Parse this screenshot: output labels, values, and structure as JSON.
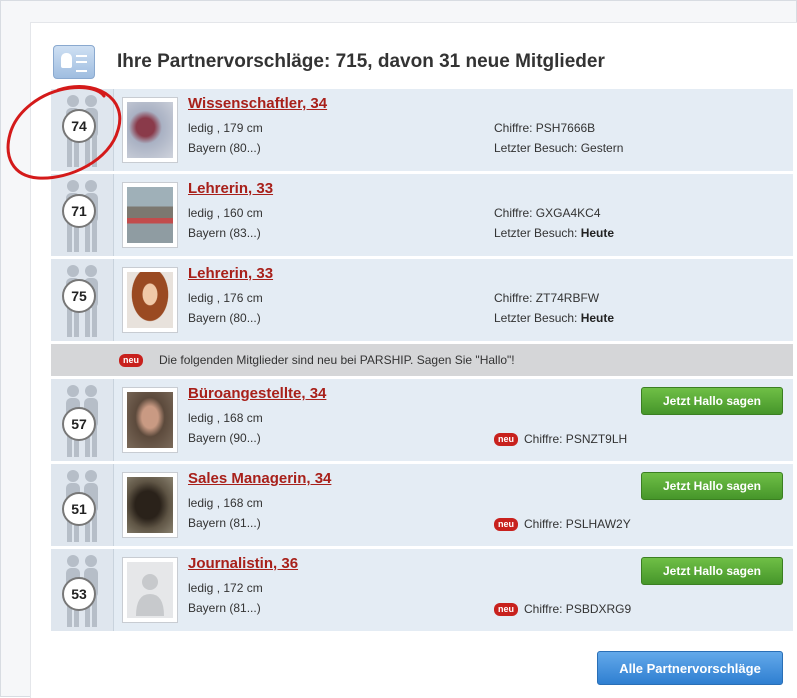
{
  "header": {
    "title": "Ihre Partnervorschläge: 715, davon 31 neue Mitglieder"
  },
  "matches": [
    {
      "score": "74",
      "name": "Wissenschaftler, 34",
      "details": "ledig , 179 cm",
      "region": "Bayern (80...)",
      "chiffre": "Chiffre: PSH7666B",
      "visit_label": "Letzter Besuch: ",
      "visit_value": "Gestern",
      "visit_bold": false,
      "photo_color": "#6e5866"
    },
    {
      "score": "71",
      "name": "Lehrerin, 33",
      "details": "ledig , 160 cm",
      "region": "Bayern (83...)",
      "chiffre": "Chiffre: GXGA4KC4",
      "visit_label": "Letzter Besuch: ",
      "visit_value": "Heute",
      "visit_bold": true,
      "photo_color": "#7f8a8c"
    },
    {
      "score": "75",
      "name": "Lehrerin, 33",
      "details": "ledig , 176 cm",
      "region": "Bayern (80...)",
      "chiffre": "Chiffre: ZT74RBFW",
      "visit_label": "Letzter Besuch: ",
      "visit_value": "Heute",
      "visit_bold": true,
      "photo_color": "#a8552e"
    }
  ],
  "divider": {
    "badge": "neu",
    "text": "Die folgenden Mitglieder sind neu bei PARSHIP. Sagen Sie \"Hallo\"!"
  },
  "new_members": [
    {
      "score": "57",
      "name": "Büroangestellte, 34",
      "details": "ledig , 168 cm",
      "region": "Bayern (90...)",
      "chiffre": "Chiffre: PSNZT9LH",
      "button": "Jetzt Hallo sagen",
      "badge": "neu",
      "photo_color": "#8a7360"
    },
    {
      "score": "51",
      "name": "Sales Managerin, 34",
      "details": "ledig , 168 cm",
      "region": "Bayern (81...)",
      "chiffre": "Chiffre: PSLHAW2Y",
      "button": "Jetzt Hallo sagen",
      "badge": "neu",
      "photo_color": "#3a3328"
    },
    {
      "score": "53",
      "name": "Journalistin, 36",
      "details": "ledig , 172 cm",
      "region": "Bayern (81...)",
      "chiffre": "Chiffre: PSBDXRG9",
      "button": "Jetzt Hallo sagen",
      "badge": "neu",
      "photo_color": "#d9dadc"
    }
  ],
  "footer": {
    "all_button": "Alle Partnervorschläge"
  },
  "colors": {
    "name_link": "#a8201a",
    "hallo_green": "#46962a",
    "all_blue": "#2f7fd1",
    "annotation_red": "#d41a1a"
  },
  "icons": {
    "header": "profile-card-icon",
    "match_figure": "couple-silhouette-icon",
    "placeholder_photo": "person-placeholder-icon"
  }
}
